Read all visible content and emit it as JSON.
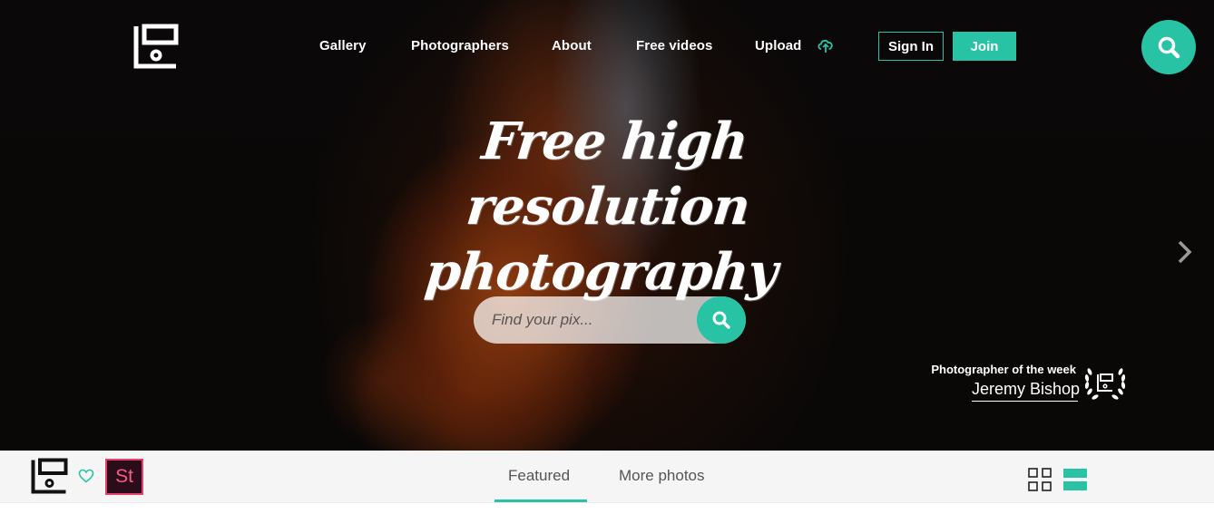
{
  "nav": {
    "links": [
      "Gallery",
      "Photographers",
      "About",
      "Free videos",
      "Upload"
    ],
    "sign_in": "Sign In",
    "join": "Join",
    "upload_icon": "cloud-upload-icon",
    "search_icon": "search-icon"
  },
  "hero": {
    "headline_line1": "Free high resolution",
    "headline_line2": "photography",
    "search_placeholder": "Find your pix...",
    "photographer_of_week_label": "Photographer of the week",
    "photographer_name": "Jeremy Bishop"
  },
  "bottombar": {
    "tabs": [
      "Featured",
      "More photos"
    ],
    "active_tab": "Featured",
    "stock_badge": "St"
  },
  "colors": {
    "accent": "#27c3a4",
    "stock_pink": "#e5416f"
  }
}
